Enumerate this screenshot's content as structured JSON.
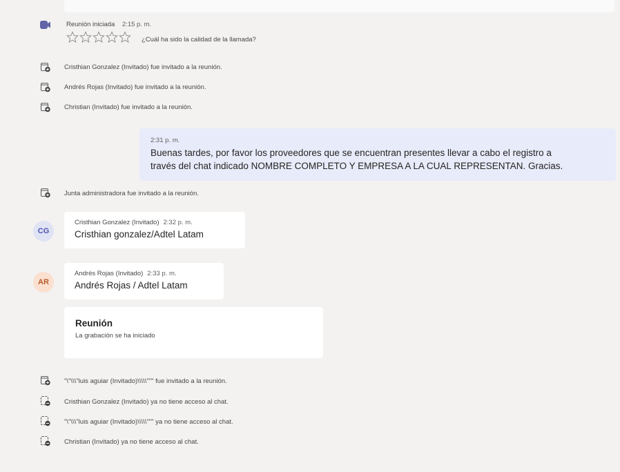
{
  "meeting_started": {
    "label": "Reunión iniciada",
    "time": "2:15 p. m.",
    "rating_prompt": "¿Cuál ha sido la calidad de la llamada?",
    "rating": 0,
    "stars_total": 5
  },
  "events_top": [
    {
      "text": "Cristhian Gonzalez (Invitado) fue invitado a la reunión.",
      "icon": "calendar-add-icon"
    },
    {
      "text": "Andrés Rojas (Invitado) fue invitado a la reunión.",
      "icon": "calendar-add-icon"
    },
    {
      "text": "Christian (Invitado) fue invitado a la reunión.",
      "icon": "calendar-add-icon"
    }
  ],
  "my_message": {
    "time": "2:31 p. m.",
    "line1": "Buenas tardes, por favor los proveedores que se encuentran presentes llevar a cabo el registro a",
    "line2": "través del chat indicado NOMBRE COMPLETO Y EMPRESA A LA CUAL REPRESENTAN. Gracias."
  },
  "event_mid": {
    "text": "Junta administradora fue invitado a la reunión.",
    "icon": "calendar-add-icon"
  },
  "messages": [
    {
      "initials": "CG",
      "author": "Cristhian Gonzalez (Invitado)",
      "time": "2:32 p. m.",
      "body": "Cristhian gonzalez/Adtel Latam",
      "avatar_bg": "#e0e3f4",
      "avatar_fg": "#4f52b2"
    },
    {
      "initials": "AR",
      "author": "Andrés Rojas (Invitado)",
      "time": "2:33 p. m.",
      "body": "Andrés Rojas / Adtel Latam",
      "avatar_bg": "#fbe0d0",
      "avatar_fg": "#b85c2a"
    }
  ],
  "recording": {
    "title": "Reunión",
    "subtitle": "La grabación se ha iniciado"
  },
  "events_bottom": [
    {
      "text": "\"\\\"\\\\\\\"luis aguiar (Invitado)\\\\\\\\\\\"\"\" fue invitado a la reunión.",
      "icon": "calendar-add-icon"
    },
    {
      "text": "Cristhian Gonzalez (Invitado) ya no tiene acceso al chat.",
      "icon": "calendar-remove-icon"
    },
    {
      "text": "\"\\\"\\\\\\\"luis aguiar (Invitado)\\\\\\\\\\\"\"\" ya no tiene acceso al chat.",
      "icon": "calendar-remove-icon"
    },
    {
      "text": "Christian (Invitado) ya no tiene acceso al chat.",
      "icon": "calendar-remove-icon"
    }
  ],
  "colors": {
    "accent": "#6264a7",
    "my_bubble": "#e8ebfa",
    "background": "#f3f2f1"
  }
}
